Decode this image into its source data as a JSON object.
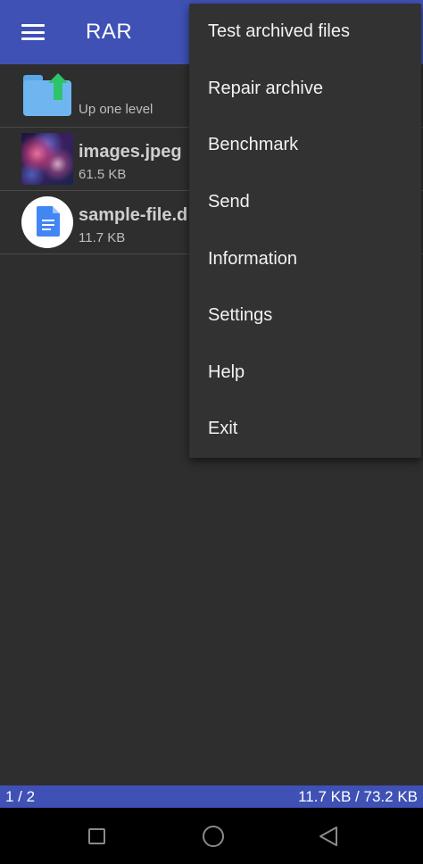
{
  "appbar": {
    "title": "RAR",
    "menu_icon": "hamburger-menu-icon"
  },
  "files": [
    {
      "type": "parent",
      "icon": "folder-up-icon",
      "name": "",
      "detail": "Up one level"
    },
    {
      "type": "image",
      "icon": "image-thumbnail",
      "name": "images.jpeg",
      "detail": "61.5 KB"
    },
    {
      "type": "document",
      "icon": "document-icon",
      "name": "sample-file.d",
      "detail": "11.7 KB"
    }
  ],
  "overflow_menu": {
    "items": [
      "Test archived files",
      "Repair archive",
      "Benchmark",
      "Send",
      "Information",
      "Settings",
      "Help",
      "Exit"
    ]
  },
  "statusbar": {
    "position": "1 / 2",
    "size": "11.7 KB / 73.2 KB"
  },
  "navbar": {
    "recents_icon": "recents-square-icon",
    "home_icon": "home-circle-icon",
    "back_icon": "back-triangle-icon"
  },
  "colors": {
    "primary": "#3f51b5",
    "background": "#2e2e2e",
    "menu_background": "#323232",
    "folder": "#6fb6f0",
    "folder_arrow": "#2ec46a",
    "doc_blue": "#4285f4"
  }
}
